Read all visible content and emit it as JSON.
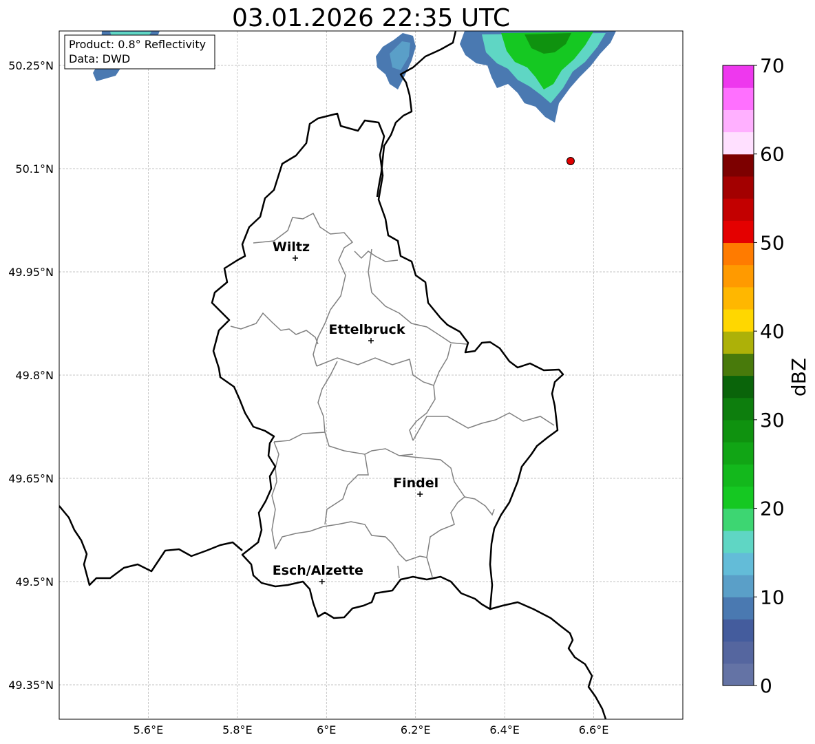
{
  "title": "03.01.2026 22:35 UTC",
  "info_box": {
    "product": "Product: 0.8° Reflectivity",
    "data": "Data: DWD"
  },
  "map": {
    "lon_range": [
      5.4,
      6.8
    ],
    "lat_range": [
      49.3,
      50.3
    ],
    "lon_ticks": [
      5.6,
      5.8,
      6.0,
      6.2,
      6.4,
      6.6
    ],
    "lon_tick_labels": [
      "5.6°E",
      "5.8°E",
      "6°E",
      "6.2°E",
      "6.4°E",
      "6.6°E"
    ],
    "lat_ticks": [
      50.25,
      50.1,
      49.95,
      49.8,
      49.65,
      49.5,
      49.35
    ],
    "lat_tick_labels": [
      "50.25°N",
      "50.1°N",
      "49.95°N",
      "49.8°N",
      "49.65°N",
      "49.5°N",
      "49.35°N"
    ],
    "grid": true,
    "cities": [
      {
        "name": "Wiltz",
        "lon": 5.93,
        "lat": 49.97
      },
      {
        "name": "Ettelbruck",
        "lon": 6.1,
        "lat": 49.85
      },
      {
        "name": "Findel",
        "lon": 6.21,
        "lat": 49.627
      },
      {
        "name": "Esch/Alzette",
        "lon": 5.99,
        "lat": 49.5
      }
    ],
    "radar_site": {
      "lon": 6.548,
      "lat": 50.111,
      "color": "#e00000"
    }
  },
  "colorbar": {
    "label": "dBZ",
    "min": 0,
    "max": 70,
    "tick_values": [
      0,
      10,
      20,
      30,
      40,
      50,
      60,
      70
    ],
    "tick_labels": [
      "0",
      "10",
      "20",
      "30",
      "40",
      "50",
      "60",
      "70"
    ],
    "colors": [
      "#6473a5",
      "#55669f",
      "#445c9d",
      "#4a79b1",
      "#5a9fc8",
      "#63bcd8",
      "#5fd6c4",
      "#3dd672",
      "#15c822",
      "#13b81c",
      "#11a515",
      "#0f920f",
      "#0d7e0d",
      "#0a640a",
      "#487a0b",
      "#adb108",
      "#ffd700",
      "#ffb700",
      "#ff9a00",
      "#ff7b00",
      "#e40000",
      "#c30000",
      "#a30000",
      "#7d0000",
      "#ffe0ff",
      "#ffb0ff",
      "#ff70ff",
      "#ee38ee"
    ]
  }
}
